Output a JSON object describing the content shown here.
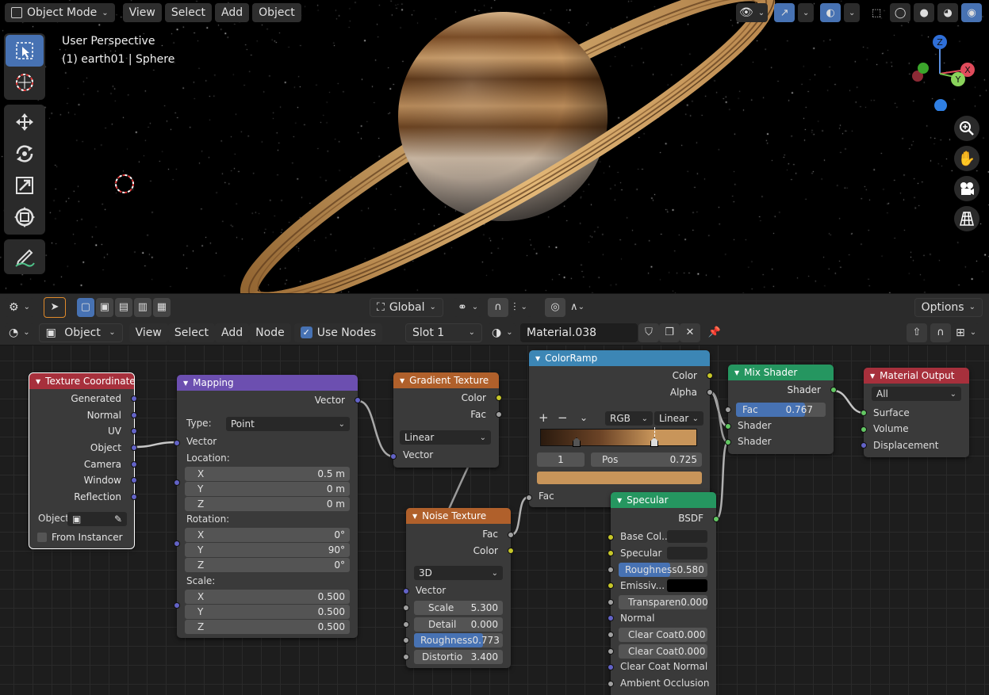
{
  "viewport": {
    "mode": "Object Mode",
    "menu": [
      "View",
      "Select",
      "Add",
      "Object"
    ],
    "perspective": "User Perspective",
    "object_info": "(1) earth01 | Sphere",
    "gizmo": {
      "z": "Z",
      "x": "X",
      "y": "Y"
    }
  },
  "toolsettings": {
    "orientation": "Global",
    "options": "Options"
  },
  "node_header": {
    "editor_type": "Object",
    "menu": [
      "View",
      "Select",
      "Add",
      "Node"
    ],
    "use_nodes": "Use Nodes",
    "slot": "Slot 1",
    "material": "Material.038"
  },
  "nodes": {
    "texcoord": {
      "title": "Texture Coordinate",
      "outputs": [
        "Generated",
        "Normal",
        "UV",
        "Object",
        "Camera",
        "Window",
        "Reflection"
      ],
      "object_label": "Object",
      "from_instancer": "From Instancer"
    },
    "mapping": {
      "title": "Mapping",
      "out": "Vector",
      "type_label": "Type:",
      "type_value": "Point",
      "vector": "Vector",
      "location": "Location:",
      "loc": {
        "x": "0.5 m",
        "y": "0 m",
        "z": "0 m"
      },
      "rotation": "Rotation:",
      "rot": {
        "x": "0°",
        "y": "90°",
        "z": "0°"
      },
      "scale": "Scale:",
      "scl": {
        "x": "0.500",
        "y": "0.500",
        "z": "0.500"
      },
      "axis": {
        "x": "X",
        "y": "Y",
        "z": "Z"
      }
    },
    "gradient": {
      "title": "Gradient Texture",
      "out_color": "Color",
      "out_fac": "Fac",
      "type": "Linear",
      "vector": "Vector"
    },
    "colorramp": {
      "title": "ColorRamp",
      "out_color": "Color",
      "out_alpha": "Alpha",
      "plus": "+",
      "minus": "−",
      "mode": "RGB",
      "interp": "Linear",
      "index": "1",
      "pos_label": "Pos",
      "pos_value": "0.725",
      "in_fac": "Fac"
    },
    "noise": {
      "title": "Noise Texture",
      "out_fac": "Fac",
      "out_color": "Color",
      "dim": "3D",
      "vector": "Vector",
      "scale_label": "Scale",
      "scale": "5.300",
      "detail_label": "Detail",
      "detail": "0.000",
      "rough_label": "Roughness",
      "rough": "0.773",
      "rough_fill": 0.773,
      "dist_label": "Distortio",
      "dist": "3.400"
    },
    "mix": {
      "title": "Mix Shader",
      "out": "Shader",
      "fac_label": "Fac",
      "fac": "0.767",
      "fac_fill": 0.767,
      "in1": "Shader",
      "in2": "Shader"
    },
    "output": {
      "title": "Material Output",
      "target": "All",
      "surface": "Surface",
      "volume": "Volume",
      "displacement": "Displacement"
    },
    "specular": {
      "title": "Specular",
      "out": "BSDF",
      "base_color": "Base Col...",
      "specular": "Specular",
      "rough_label": "Roughness",
      "rough": "0.580",
      "rough_fill": 0.58,
      "emissive": "Emissiv...",
      "transp_label": "Transparen",
      "transp": "0.000",
      "normal": "Normal",
      "cc_label": "Clear Coat",
      "cc": "0.000",
      "cc2_label": "Clear Coat",
      "cc2": "0.000",
      "cc_normal": "Clear Coat Normal",
      "ao": "Ambient Occlusion"
    }
  },
  "colors": {
    "accent": "#4772b3",
    "input_header": "#a7303c",
    "vector_header": "#6c4fb0",
    "texture_header": "#b0602b",
    "converter_header": "#3c86b5",
    "shader_header": "#259660",
    "output_header": "#a7303c",
    "ramp_dark": "#2a1a0e",
    "ramp_light": "#c8955a"
  }
}
